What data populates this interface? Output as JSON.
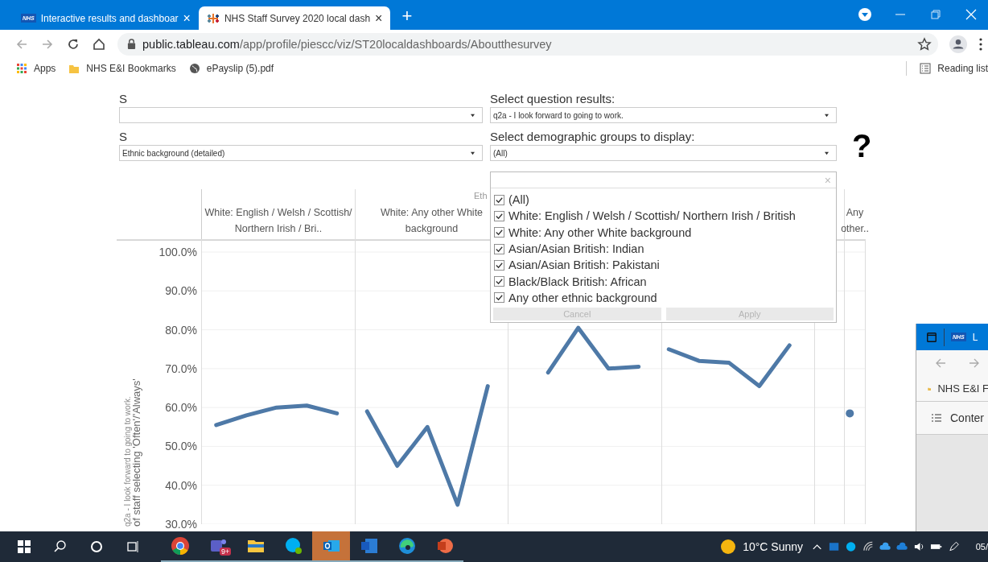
{
  "browser": {
    "tabs": [
      {
        "title": "Interactive results and dashboar",
        "logo": "NHS",
        "close": "×",
        "selected": false
      },
      {
        "title": "NHS Staff Survey 2020 local dash",
        "close": "×",
        "selected": true
      }
    ],
    "new_tab": "+",
    "url_domain": "public.tableau.com",
    "url_path": "/app/profile/piescc/viz/ST20localdashboards/Aboutthesurvey",
    "bookmarks": [
      {
        "kind": "apps",
        "label": "Apps"
      },
      {
        "kind": "folder",
        "label": "NHS E&I Bookmarks"
      },
      {
        "kind": "globe",
        "label": "ePayslip (5).pdf"
      }
    ],
    "reading_list": "Reading list"
  },
  "filters": [
    {
      "label": "S"
    },
    {
      "label": "Select question results:",
      "value": "q2a - I look forward to going to work."
    },
    {
      "label": "S",
      "value": "Ethnic background (detailed)"
    },
    {
      "label": "Select demographic groups to display:",
      "value": "(All)"
    }
  ],
  "help": "?",
  "dropdown": {
    "clear": "×",
    "items": [
      {
        "label": "(All)",
        "checked": true
      },
      {
        "label": "White: English / Welsh / Scottish/ Northern Irish / British",
        "checked": true
      },
      {
        "label": "White: Any other White background",
        "checked": true
      },
      {
        "label": "Asian/Asian British: Indian",
        "checked": true
      },
      {
        "label": "Asian/Asian British: Pakistani",
        "checked": true
      },
      {
        "label": "Black/Black British: African",
        "checked": true
      },
      {
        "label": "Any other ethnic background",
        "checked": true
      }
    ],
    "buttons": [
      {
        "label": "Cancel",
        "disabled": true
      },
      {
        "label": "Apply",
        "disabled": true
      }
    ]
  },
  "chart": {
    "axis_title": "Eth",
    "question_title": "q2a - I look forward to going to work.",
    "headers": {
      "column_1": "White: English / Welsh / Scottish/ Northern Irish / Bri..",
      "column_2": "White: Any other White background",
      "column_6": "Any other.."
    },
    "chart_data": {
      "type": "line",
      "ylabel": "of staff selecting 'Often'/'Always'",
      "ylim": [
        30,
        100
      ],
      "grid": true,
      "yticks": [
        {
          "value": 30,
          "label": "30.0%"
        },
        {
          "value": 40,
          "label": "40.0%"
        },
        {
          "value": 50,
          "label": "50.0%"
        },
        {
          "value": 60,
          "label": "60.0%"
        },
        {
          "value": 70,
          "label": "70.0%"
        },
        {
          "value": 80,
          "label": "80.0%"
        },
        {
          "value": 90,
          "label": "90.0%"
        },
        {
          "value": 100,
          "label": "100.0%"
        }
      ],
      "series": [
        {
          "color": "#4e79a7",
          "values": [
            55.5,
            58,
            60,
            60.5,
            58.5,
            null,
            null,
            null,
            null,
            null,
            null,
            null,
            null,
            null,
            null,
            null,
            null,
            null,
            null,
            null,
            null,
            null
          ]
        },
        {
          "color": "#4e79a7",
          "values": [
            null,
            null,
            null,
            null,
            null,
            59,
            45,
            55,
            35,
            65.5,
            null,
            null,
            null,
            null,
            null,
            null,
            null,
            null,
            null,
            null,
            null,
            null
          ]
        },
        {
          "color": "#4e79a7",
          "values": [
            null,
            null,
            null,
            null,
            null,
            null,
            null,
            null,
            null,
            null,
            null,
            69,
            80.5,
            70,
            70.5,
            null,
            null,
            null,
            null,
            null,
            null,
            null
          ]
        },
        {
          "color": "#4e79a7",
          "values": [
            null,
            null,
            null,
            null,
            null,
            null,
            null,
            null,
            null,
            null,
            null,
            null,
            null,
            null,
            null,
            75,
            72,
            71.5,
            65.5,
            76,
            null,
            null
          ]
        },
        {
          "color": "#4e79a7",
          "marker": true,
          "values": [
            null,
            null,
            null,
            null,
            null,
            null,
            null,
            null,
            null,
            null,
            null,
            null,
            null,
            null,
            null,
            null,
            null,
            null,
            null,
            null,
            null,
            58.5
          ]
        }
      ]
    }
  },
  "side_window": {
    "logo": "NHS",
    "title": "L",
    "bookmark": "NHS E&I F",
    "contents": "Conter"
  },
  "taskbar": {
    "apps": [
      {
        "kind": "chrome",
        "active": false
      },
      {
        "kind": "teams",
        "badge": "9+",
        "active": false
      },
      {
        "kind": "folder",
        "active": false
      },
      {
        "kind": "skype",
        "active": false
      },
      {
        "kind": "outlook",
        "active": true
      },
      {
        "kind": "word",
        "active": false
      },
      {
        "kind": "edge",
        "active": false
      },
      {
        "kind": "powerpoint",
        "active": false
      }
    ],
    "weather": "10°C Sunny",
    "clock": "05/"
  }
}
